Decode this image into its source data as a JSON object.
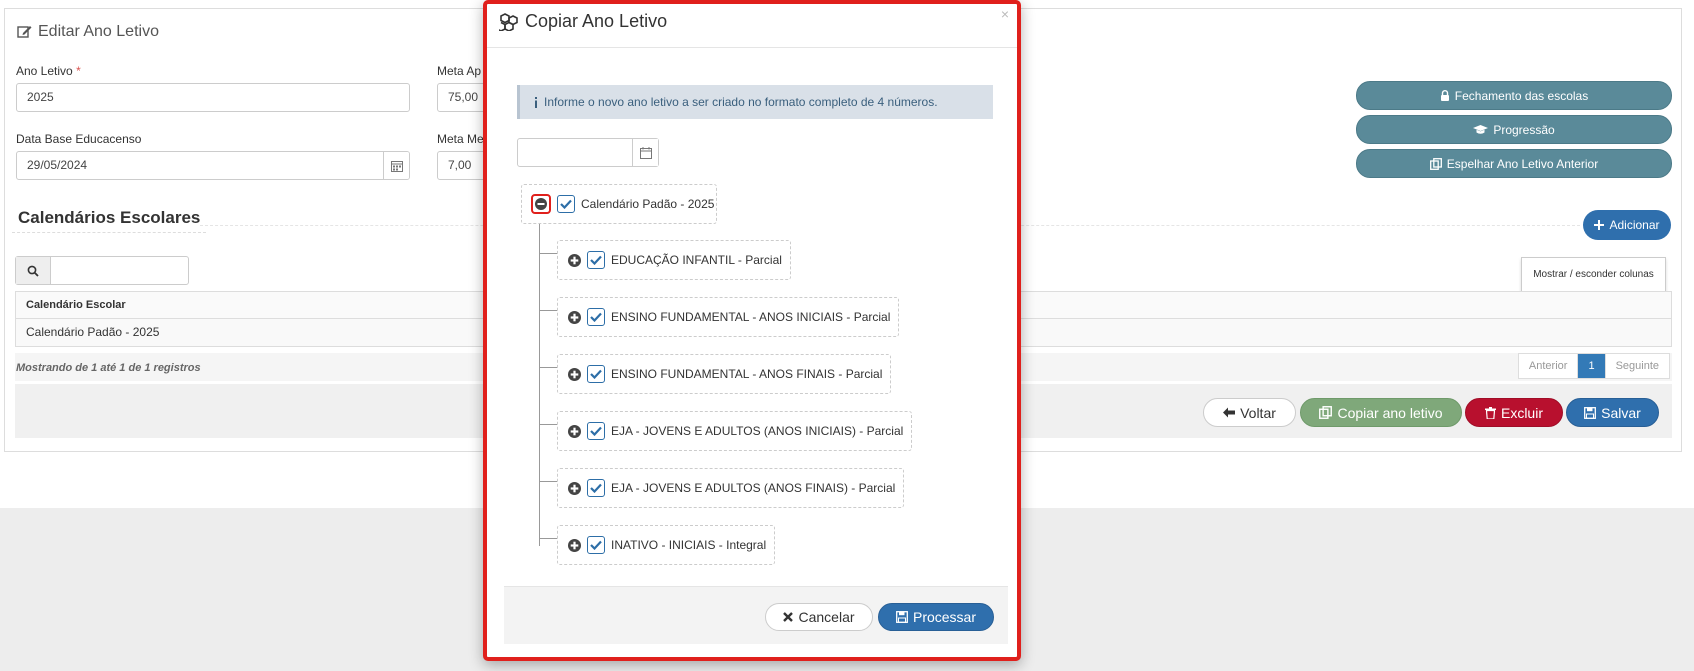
{
  "form": {
    "title": "Editar Ano Letivo",
    "ano_letivo_label": "Ano Letivo",
    "required_mark": "*",
    "ano_letivo_value": "2025",
    "meta_aprov_label": "Meta Ap",
    "meta_aprov_value": "75,00",
    "data_base_label": "Data Base Educacenso",
    "data_base_value": "29/05/2024",
    "meta_media_label": "Meta Me",
    "meta_media_value": "7,00"
  },
  "side_buttons": {
    "fechamento": "Fechamento das escolas",
    "progressao": "Progressão",
    "espelhar": "Espelhar Ano Letivo Anterior"
  },
  "calendarios": {
    "section_title": "Calendários Escolares",
    "add_label": "Adicionar",
    "columns_toggle": "Mostrar / esconder colunas",
    "column_header": "Calendário Escolar",
    "rows": [
      "Calendário Padão - 2025"
    ],
    "info": "Mostrando de 1 até 1 de 1 registros",
    "pager": {
      "prev": "Anterior",
      "current": "1",
      "next": "Seguinte"
    }
  },
  "actions": {
    "voltar": "Voltar",
    "copiar": "Copiar ano letivo",
    "excluir": "Excluir",
    "salvar": "Salvar"
  },
  "modal": {
    "title": "Copiar Ano Letivo",
    "close": "×",
    "info": "Informe o novo ano letivo a ser criado no formato completo de 4 números.",
    "year_value": "",
    "root_label": "Calendário Padão - 2025",
    "nodes": [
      "EDUCAÇÃO INFANTIL - Parcial",
      "ENSINO FUNDAMENTAL - ANOS INICIAIS - Parcial",
      "ENSINO FUNDAMENTAL - ANOS FINAIS - Parcial",
      "EJA - JOVENS E ADULTOS (ANOS INICIAIS) - Parcial",
      "EJA - JOVENS E ADULTOS (ANOS FINAIS) - Parcial",
      "INATIVO - INICIAIS - Integral"
    ],
    "cancel_label": "Cancelar",
    "process_label": "Processar"
  },
  "colors": {
    "primary": "#2f6fad",
    "teal": "#5a8a99",
    "success": "#7fa87a",
    "danger": "#b8102e",
    "highlight": "#e0201c"
  }
}
